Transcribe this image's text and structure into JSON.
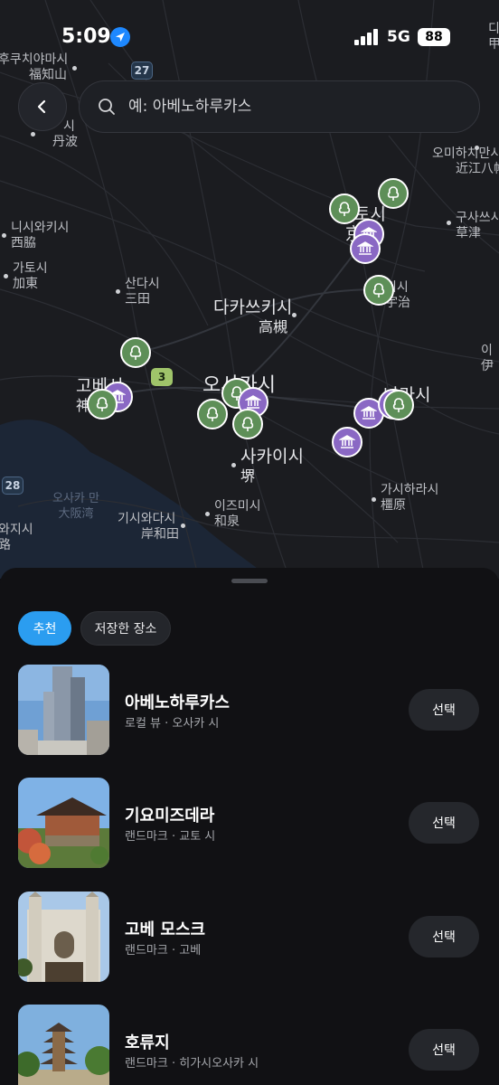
{
  "status_bar": {
    "time": "5:09",
    "network": "5G",
    "battery": "88"
  },
  "search": {
    "placeholder": "예: 아베노하루카스"
  },
  "map": {
    "places": [
      {
        "kr": "후쿠치야마시",
        "jp": "福知山"
      },
      {
        "kr": "시",
        "jp": "丹波"
      },
      {
        "kr": "니시와키시",
        "jp": "西脇"
      },
      {
        "kr": "가토시",
        "jp": "加東"
      },
      {
        "kr": "산다시",
        "jp": "三田"
      },
      {
        "kr": "다카쓰키시",
        "jp": "高槻"
      },
      {
        "kr": "오미하치만시",
        "jp": "近江八幡"
      },
      {
        "kr": "구사쓰시",
        "jp": "草津"
      },
      {
        "kr": "지시",
        "jp": "宇治"
      },
      {
        "kr": "고베시",
        "jp": "神戸"
      },
      {
        "kr": "오사카시",
        "jp": ""
      },
      {
        "kr": "나라시",
        "jp": ""
      },
      {
        "kr": "사카이시",
        "jp": "堺"
      },
      {
        "kr": "가시하라시",
        "jp": "橿原"
      },
      {
        "kr": "이즈미시",
        "jp": "和泉"
      },
      {
        "kr": "기시와다시",
        "jp": "岸和田"
      },
      {
        "kr": "와지시",
        "jp": "路"
      },
      {
        "kr": "토시",
        "jp": "京"
      },
      {
        "kr": "이",
        "jp": "伊"
      },
      {
        "kr": "디",
        "jp": "甲"
      }
    ],
    "sea_label": {
      "kr": "오사카 만",
      "jp": "大阪湾"
    },
    "route_badges": [
      "27",
      "3",
      "28"
    ]
  },
  "tabs": [
    {
      "label": "추천",
      "active": true
    },
    {
      "label": "저장한 장소",
      "active": false
    }
  ],
  "places_list": [
    {
      "title": "아베노하루카스",
      "subtitle": "로컬 뷰 · 오사카 시",
      "button": "선택"
    },
    {
      "title": "기요미즈데라",
      "subtitle": "랜드마크 · 교토 시",
      "button": "선택"
    },
    {
      "title": "고베 모스크",
      "subtitle": "랜드마크 · 고베",
      "button": "선택"
    },
    {
      "title": "호류지",
      "subtitle": "랜드마크 · 히가시오사카 시",
      "button": "선택"
    }
  ],
  "colors": {
    "accent": "#2b9df0",
    "tree_pin": "#5e8f58",
    "museum_pin": "#8a68c4"
  }
}
